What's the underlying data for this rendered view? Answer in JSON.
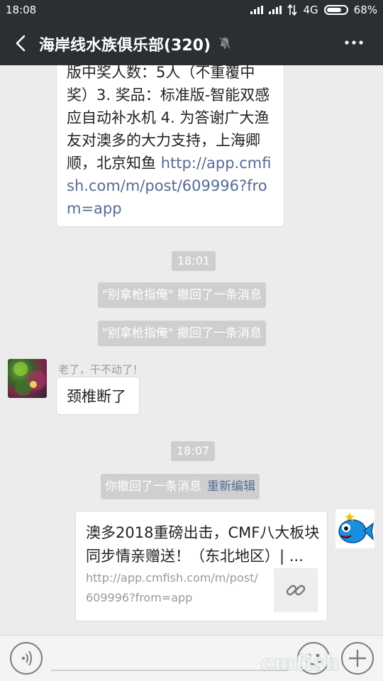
{
  "status_bar": {
    "time": "18:08",
    "network": "4G",
    "battery": "68%"
  },
  "header": {
    "title": "海岸线水族俱乐部(320)",
    "icons": [
      "back-arrow-icon",
      "mute-bell-icon",
      "more-dots-icon"
    ]
  },
  "messages": {
    "partial_bubble": {
      "text": "版中奖人数：5人（不重覆中奖）3. 奖品：标准版-智能双感应自动补水机 4. 为答谢广大渔友对澳多的大力支持，上海卿顺，北京知鱼 ",
      "link": "http://app.cmfish.com/m/post/609996?from=app"
    },
    "timestamp_1": "18:01",
    "recall_1": "\"别拿枪指俺\" 撤回了一条消息",
    "recall_2": "\"别拿枪指俺\" 撤回了一条消息",
    "left_message": {
      "sender": "老了，干不动了！",
      "text": "颈椎断了"
    },
    "timestamp_2": "18:07",
    "own_recall": {
      "text": "你撤回了一条消息",
      "action": "重新编辑"
    },
    "link_card": {
      "title": "澳多2018重磅出击，CMF八大板块同步情亲赠送！（东北地区）| ...",
      "url": "http://app.cmfish.com/m/post/609996?from=app",
      "thumb_icon": "link-chain-icon"
    }
  },
  "input_bar": {
    "icons": [
      "voice-icon",
      "emoji-icon",
      "plus-icon"
    ]
  },
  "watermark": "cmfish",
  "colors": {
    "header_bg": "#2b2e33",
    "chat_bg": "#ececec",
    "link_color": "#576b95",
    "system_bg": "#cfcfcf"
  }
}
